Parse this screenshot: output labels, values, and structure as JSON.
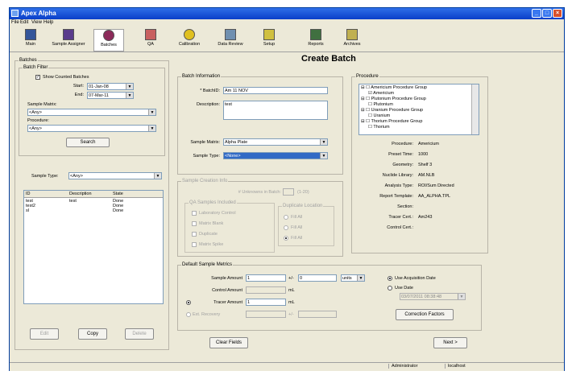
{
  "window": {
    "title": "Apex Alpha"
  },
  "menu": [
    "File",
    "Edit",
    "View",
    "Help"
  ],
  "toolbar": [
    {
      "label": "Main",
      "icon": "main-icon",
      "color": "#34569a"
    },
    {
      "label": "Sample Assigner",
      "icon": "sample-assigner-icon",
      "color": "#5a3c8c"
    },
    {
      "label": "Batches",
      "icon": "batches-icon",
      "color": "#8c2a5a"
    },
    {
      "label": "QA",
      "icon": "qa-icon",
      "color": "#c86060"
    },
    {
      "label": "Calibration",
      "icon": "radiation-icon",
      "color": "#e0c020"
    },
    {
      "label": "Data Review",
      "icon": "data-review-icon",
      "color": "#7090b0"
    },
    {
      "label": "Setup",
      "icon": "setup-icon",
      "color": "#d0c040"
    },
    {
      "label": "Reports",
      "icon": "reports-icon",
      "color": "#407040"
    },
    {
      "label": "Archives",
      "icon": "archives-icon",
      "color": "#c0b050"
    }
  ],
  "page": {
    "title": "Create Batch"
  },
  "left": {
    "batches_label": "Batches",
    "filter_label": "Batch Filter",
    "show_counted": "Show Counted Batches",
    "start_label": "Start:",
    "start_value": "01-Jan-08",
    "end_label": "End:",
    "end_value": "07-Mar-11",
    "matrix_label": "Sample Matrix:",
    "matrix_value": "<Any>",
    "procedure_label": "Procedure:",
    "procedure_value": "<Any>",
    "search": "Search",
    "sample_type_label": "Sample Type:",
    "sample_type_value": "<Any>",
    "columns": [
      "ID",
      "Description",
      "State"
    ],
    "rows": [
      {
        "id": "test",
        "desc": "test",
        "state": "Done"
      },
      {
        "id": "test2",
        "desc": "",
        "state": "Done"
      },
      {
        "id": "sl",
        "desc": "",
        "state": "Done"
      }
    ],
    "edit": "Edit",
    "copy": "Copy",
    "delete": "Delete"
  },
  "batch_info": {
    "legend": "Batch Information",
    "id_label": "* BatchID:",
    "id_value": "Am 11 NOV",
    "desc_label": "Description:",
    "desc_value": "test",
    "matrix_label": "Sample Matrix:",
    "matrix_value": "Alpha Plate",
    "type_label": "Sample Type:",
    "type_value": "<None>"
  },
  "creation": {
    "legend": "Sample Creation Info",
    "unknowns_label": "# Unknowns in Batch:",
    "unknowns_range": "(1-20)",
    "qa_legend": "QA Samples Included",
    "qa_items": [
      "Laboratory Control",
      "Matrix Blank",
      "Duplicate",
      "Matrix Spike"
    ],
    "dup_legend": "Duplicate Location",
    "dup_items": [
      "Fill All",
      "Fill All",
      "Fill All"
    ]
  },
  "metrics": {
    "legend": "Default Sample Metrics",
    "amount_label": "Sample Amount",
    "amount_value": "1",
    "pm": "+/-",
    "unc_value": "0",
    "units": "units",
    "control_label": "Control Amount",
    "ml": "mL",
    "tracer_label": "Tracer Amount",
    "tracer_value": "1",
    "ext_label": "Ext. Recovery",
    "use_acq": "Use Acquisition Date",
    "use_date": "Use Date",
    "date_value": "03/07/2011 08:38:48",
    "correction": "Correction Factors"
  },
  "procedure": {
    "legend": "Procedure",
    "tree": [
      {
        "label": "Americium Procedure Group",
        "level": 0,
        "checked": false
      },
      {
        "label": "Americium",
        "level": 1,
        "checked": true
      },
      {
        "label": "Plutonium Procedure Group",
        "level": 0,
        "checked": false
      },
      {
        "label": "Plutonium",
        "level": 1,
        "checked": false
      },
      {
        "label": "Uranium Procedure Group",
        "level": 0,
        "checked": false
      },
      {
        "label": "Uranium",
        "level": 1,
        "checked": false
      },
      {
        "label": "Thorium Procedure Group",
        "level": 0,
        "checked": false
      },
      {
        "label": "Thorium",
        "level": 1,
        "checked": false
      }
    ],
    "details": [
      {
        "k": "Procedure:",
        "v": "Americium"
      },
      {
        "k": "Preset Time:",
        "v": "1000"
      },
      {
        "k": "Geometry:",
        "v": "Shelf 3"
      },
      {
        "k": "Nuclide Library:",
        "v": "AM.NLB"
      },
      {
        "k": "Analysis Type:",
        "v": "ROI/Sum Directed"
      },
      {
        "k": "Report Template:",
        "v": "AA_ALPHA.TPL"
      },
      {
        "k": "Section:",
        "v": ""
      },
      {
        "k": "Tracer Cert.:",
        "v": "Am243"
      },
      {
        "k": "Control Cert.:",
        "v": ""
      }
    ]
  },
  "buttons": {
    "clear": "Clear Fields",
    "next": "Next >"
  },
  "status": {
    "user": "Administrator",
    "host": "localhost"
  }
}
